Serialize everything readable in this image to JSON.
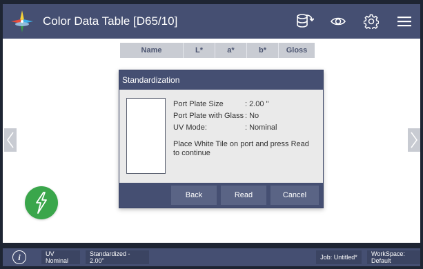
{
  "header": {
    "title": "Color Data Table [D65/10]",
    "icons": [
      "app-logo-icon",
      "database-transfer-icon",
      "eye-icon",
      "gear-icon",
      "menu-icon"
    ]
  },
  "table": {
    "columns": [
      "Name",
      "L*",
      "a*",
      "b*",
      "Gloss"
    ]
  },
  "dialog": {
    "title": "Standardization",
    "rows": [
      {
        "label": "Port Plate Size",
        "value": ": 2.00 \""
      },
      {
        "label": "Port Plate with Glass",
        "value": ": No"
      },
      {
        "label": "UV Mode:",
        "value": ": Nominal"
      }
    ],
    "instruction": "Place White Tile on port and press Read to continue",
    "buttons": {
      "back": "Back",
      "read": "Read",
      "cancel": "Cancel"
    }
  },
  "status": {
    "info_icon": "i",
    "uv_mode": "UV Nominal",
    "standardized": "Standardized - 2.00\"",
    "job": "Job: Untitled*",
    "workspace": "WorkSpace: Default"
  },
  "colors": {
    "topbar": "#454f72",
    "read_button": "#3aa64b",
    "dialog_button": "#5a6485"
  }
}
